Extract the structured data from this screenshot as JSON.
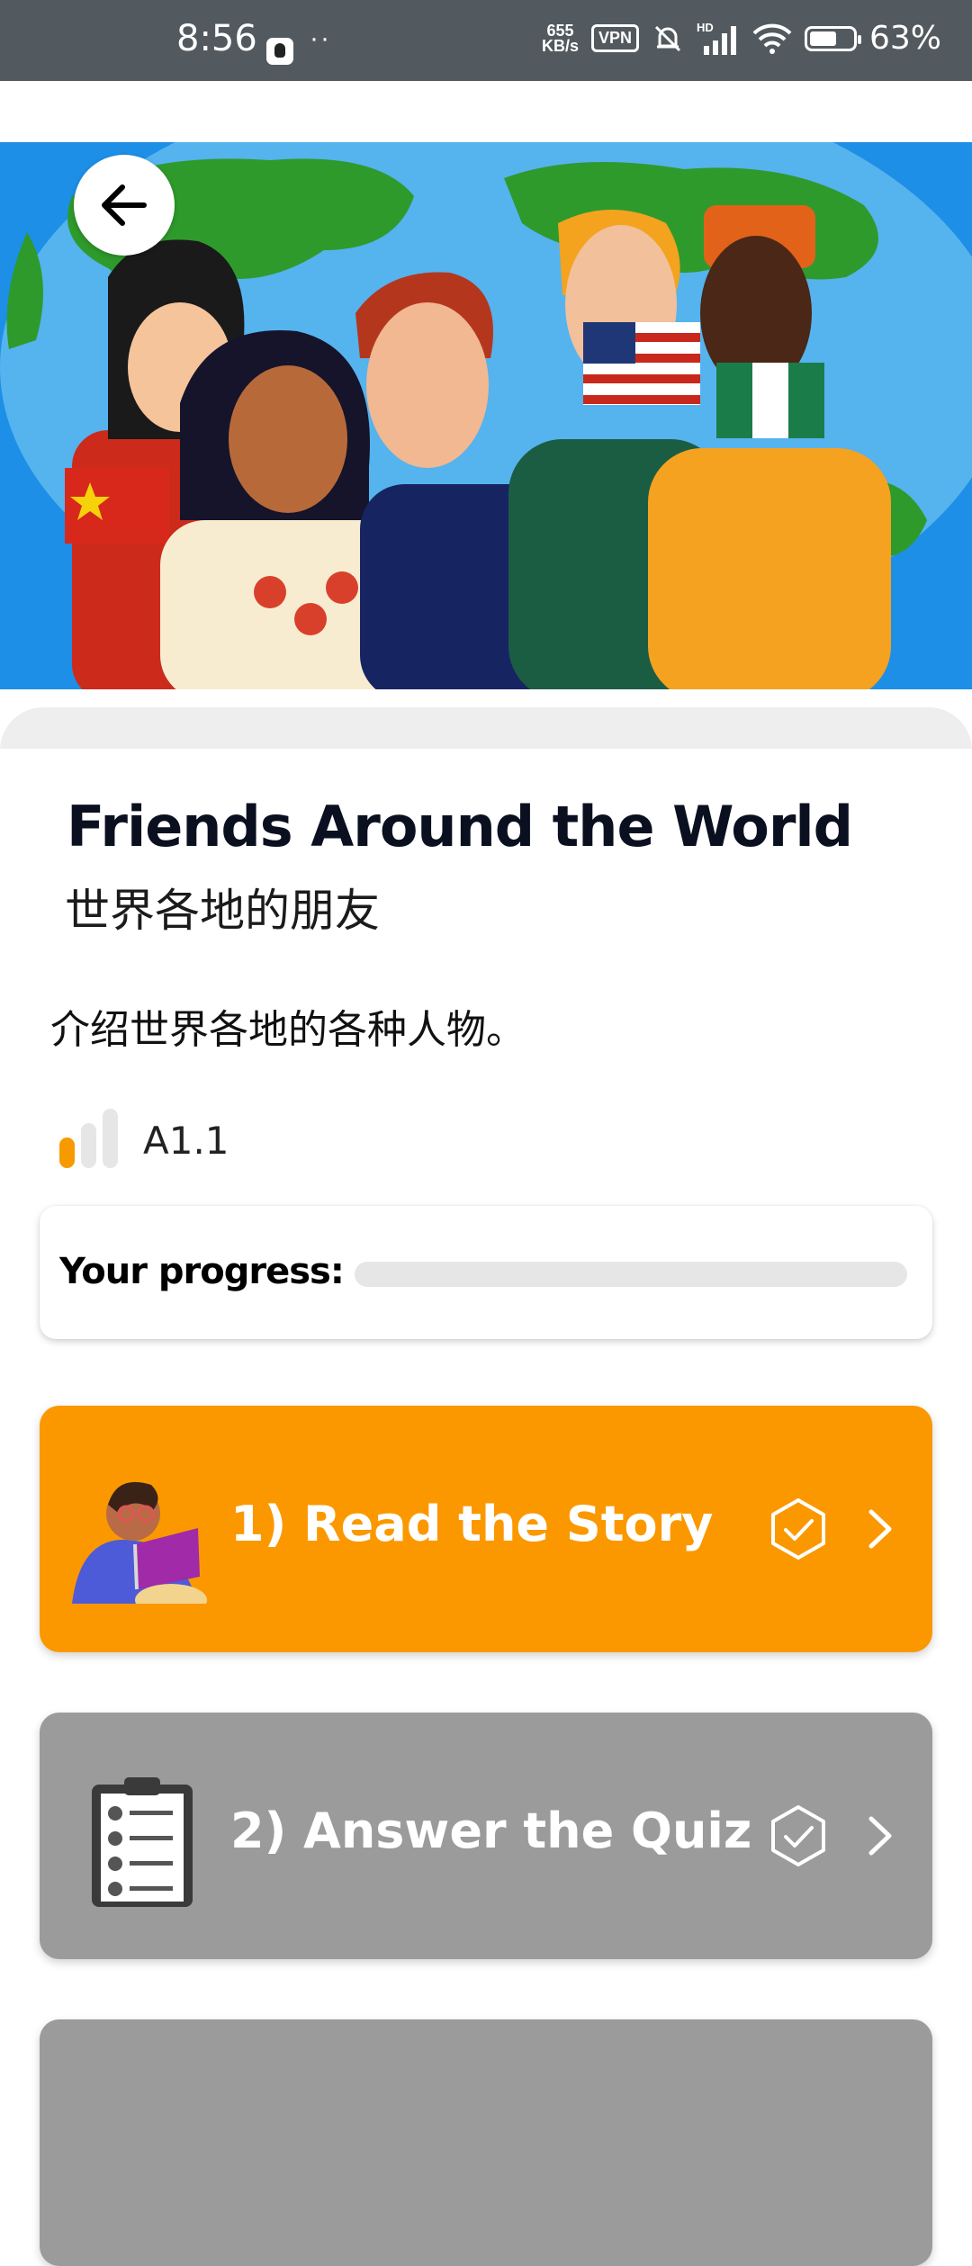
{
  "status_bar": {
    "time": "8:56",
    "dots": "··",
    "network_speed_value": "655",
    "network_speed_unit": "KB/s",
    "vpn": "VPN",
    "hd": "HD",
    "battery_percent": "63%",
    "battery_level": 0.63
  },
  "hero": {
    "image": "illustration of five friends from different countries in front of a world map",
    "back_icon": "arrow-left-icon"
  },
  "lesson": {
    "title": "Friends Around the World",
    "subtitle": "世界各地的朋友",
    "description": "介绍世界各地的各种人物。",
    "level": "A1.1",
    "level_bars_filled": 1,
    "level_bars_total": 3
  },
  "progress": {
    "label": "Your progress:",
    "value": 0
  },
  "steps": [
    {
      "label": "1) Read the Story",
      "icon": "reading-person-icon",
      "color": "#fb9800",
      "status_icon": "check-badge-icon"
    },
    {
      "label": "2) Answer the Quiz",
      "icon": "clipboard-checklist-icon",
      "color": "#9b9b9b",
      "status_icon": "check-badge-icon"
    },
    {
      "label": "",
      "icon": "",
      "color": "#9b9b9b"
    }
  ],
  "colors": {
    "accent": "#fb9800",
    "status_bar": "#535a5f",
    "inactive_card": "#9b9b9b"
  }
}
